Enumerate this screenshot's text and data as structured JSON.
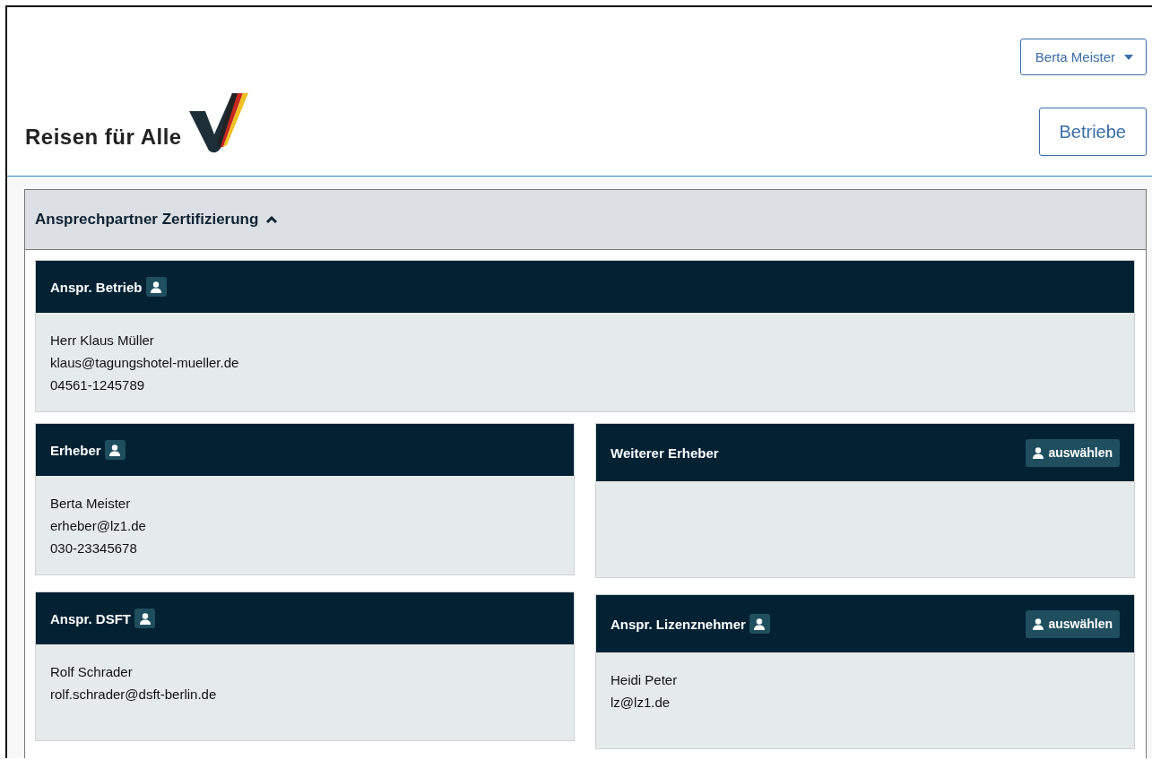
{
  "header": {
    "logo_text": "Reisen für Alle",
    "user_menu": "Berta Meister",
    "nav_button": "Betriebe"
  },
  "section": {
    "title": "Ansprechpartner Zertifizierung",
    "expanded": true,
    "full_card": {
      "title": "Anspr. Betrieb",
      "person_icon": true,
      "lines": [
        "Herr Klaus Müller",
        "klaus@tagungshotel-mueller.de",
        "04561-1245789"
      ]
    },
    "columns": [
      [
        {
          "title": "Erheber",
          "person_icon": true,
          "lines": [
            "Berta Meister",
            "erheber@lz1.de",
            "030-23345678"
          ]
        },
        {
          "title": "Anspr. DSFT",
          "person_icon": true,
          "lines": [
            "Rolf Schrader",
            "rolf.schrader@dsft-berlin.de"
          ]
        }
      ],
      [
        {
          "title": "Weiterer Erheber",
          "person_icon": false,
          "select_button": "auswählen"
        },
        {
          "title": "Anspr. Lizenznehmer",
          "person_icon": true,
          "select_button": "auswählen",
          "lines": [
            "Heidi Peter",
            "lz@lz1.de"
          ]
        }
      ]
    ]
  }
}
